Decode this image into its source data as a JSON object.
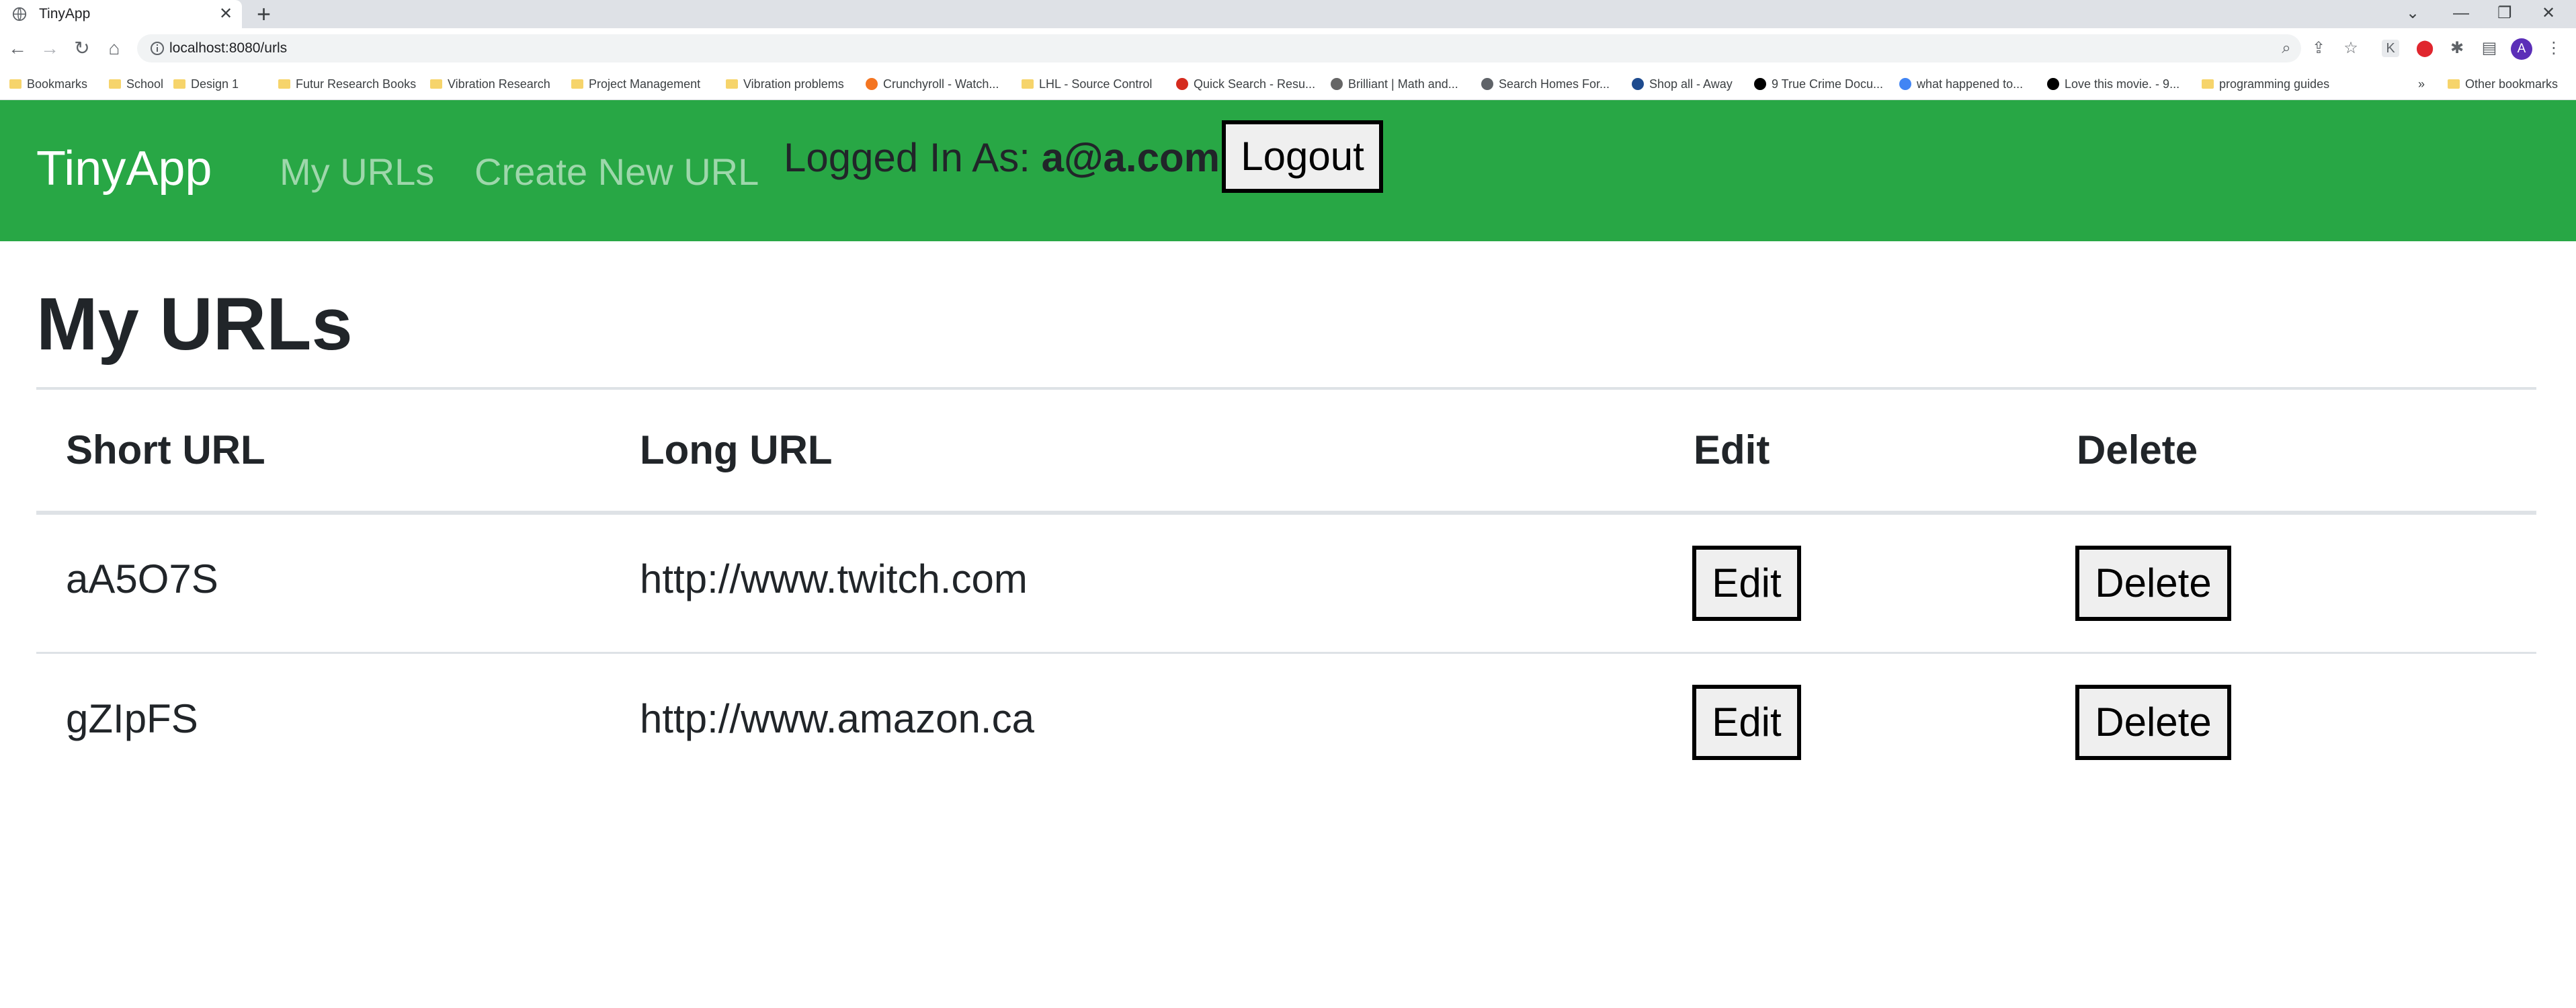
{
  "browser": {
    "tab_title": "TinyApp",
    "new_tab": "+",
    "tab_close": "✕",
    "url": "localhost:8080/urls",
    "profile_initial": "A",
    "bookmarks": [
      {
        "label": "Bookmarks",
        "icon": "folder-icon"
      },
      {
        "label": "School",
        "icon": "folder-icon"
      },
      {
        "label": "Design 1",
        "icon": "folder-icon"
      },
      {
        "label": "Futur Research Books",
        "icon": "folder-icon"
      },
      {
        "label": "Vibration Research",
        "icon": "folder-icon"
      },
      {
        "label": "Project Management",
        "icon": "folder-icon"
      },
      {
        "label": "Vibration problems",
        "icon": "folder-icon"
      },
      {
        "label": "Crunchyroll - Watch...",
        "icon": "crunchyroll-icon"
      },
      {
        "label": "LHL - Source Control",
        "icon": "folder-icon"
      },
      {
        "label": "Quick Search - Resu...",
        "icon": "maple-leaf-icon"
      },
      {
        "label": "Brilliant | Math and...",
        "icon": "brilliant-icon"
      },
      {
        "label": "Search Homes For...",
        "icon": "globe-icon"
      },
      {
        "label": "Shop all - Away",
        "icon": "away-icon"
      },
      {
        "label": "9 True Crime Docu...",
        "icon": "site-icon"
      },
      {
        "label": "what happened to...",
        "icon": "google-icon"
      },
      {
        "label": "Love this movie. - 9...",
        "icon": "site-icon"
      },
      {
        "label": "programming guides",
        "icon": "folder-icon"
      }
    ],
    "more_bookmarks": "»",
    "other_bookmarks": "Other bookmarks"
  },
  "navbar": {
    "brand": "TinyApp",
    "my_urls": "My URLs",
    "create_new": "Create New URL",
    "logged_prefix": "Logged In As: ",
    "user_email": "a@a.com",
    "logged_suffix": "!",
    "logout": "Logout"
  },
  "page": {
    "title": "My URLs"
  },
  "table": {
    "headers": [
      "Short URL",
      "Long URL",
      "Edit",
      "Delete"
    ],
    "rows": [
      {
        "short": "aA5O7S",
        "long": "http://www.twitch.com",
        "edit": "Edit",
        "delete": "Delete"
      },
      {
        "short": "gZIpFS",
        "long": "http://www.amazon.ca",
        "edit": "Edit",
        "delete": "Delete"
      }
    ]
  },
  "colors": {
    "navbar": "#28a745",
    "nav_link": "rgba(255,255,255,0.55)",
    "text": "#212529"
  }
}
